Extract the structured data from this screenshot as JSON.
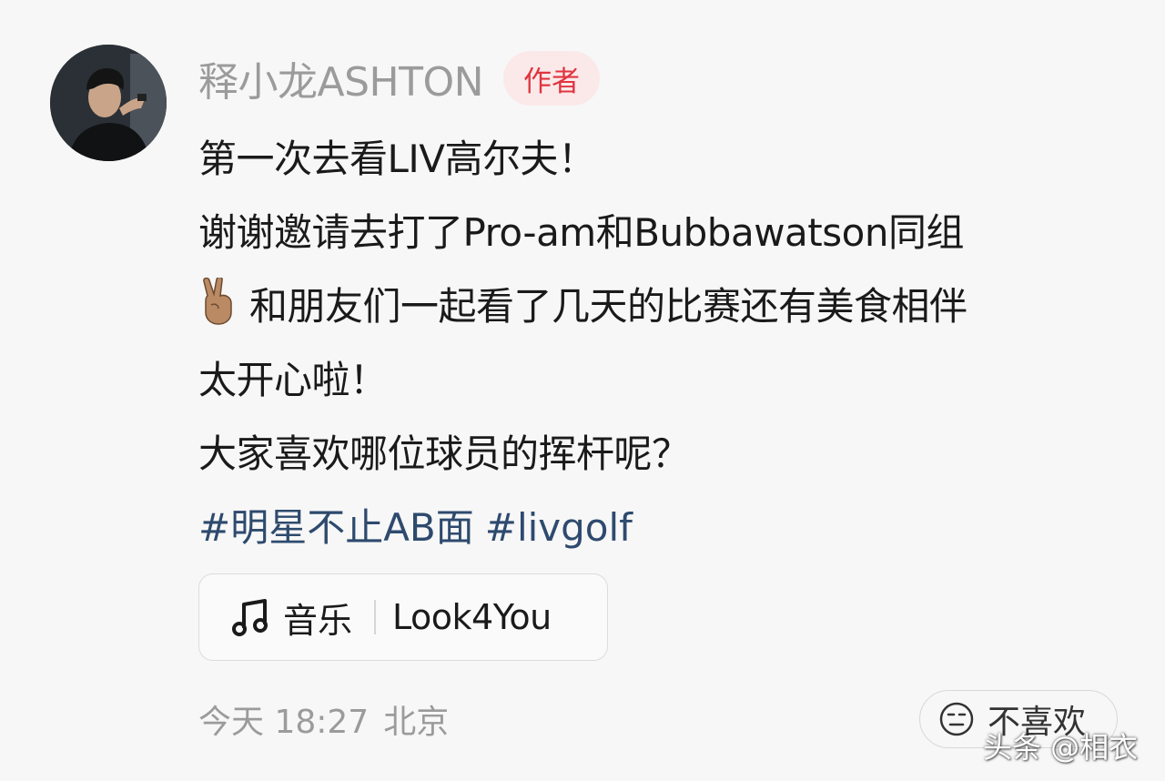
{
  "post": {
    "author": {
      "name": "释小龙ASHTON",
      "badge": "作者"
    },
    "lines": [
      "第一次去看LIV高尔夫！",
      "谢谢邀请去打了Pro-am和Bubbawatson同组",
      "和朋友们一起看了几天的比赛还有美食相伴",
      "太开心啦！",
      "大家喜欢哪位球员的挥杆呢？"
    ],
    "emoji": "✌🏽",
    "hashtags": [
      "#明星不止AB面",
      "#livgolf"
    ],
    "music": {
      "icon": "music-note-icon",
      "label": "音乐",
      "song": "Look4You"
    },
    "meta": {
      "time": "今天 18:27",
      "location": "北京"
    },
    "dislike": {
      "icon": "neutral-face-icon",
      "label": "不喜欢"
    },
    "watermark": "头条 @相衣",
    "colors": {
      "badge_bg": "#fbe9ea",
      "badge_text": "#e0353f",
      "hashtag": "#2e4a6e",
      "muted_text": "#9b9b9b",
      "background": "#f7f7f7"
    }
  }
}
